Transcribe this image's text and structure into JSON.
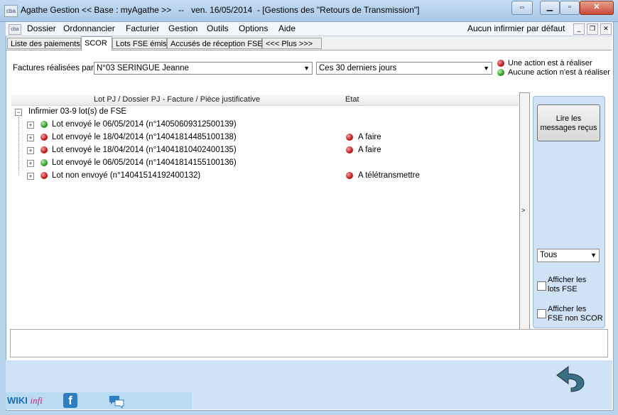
{
  "window": {
    "title": "Agathe Gestion << Base : myAgathe >>   --   ven. 16/05/2014  - [Gestions des \"Retours de Transmission\"]",
    "app_icon_text": "cba"
  },
  "menu": {
    "items": [
      "Dossier",
      "Ordonnancier",
      "Facturier",
      "Gestion",
      "Outils",
      "Options",
      "Aide"
    ],
    "right_status": "Aucun infirmier par défaut"
  },
  "tabs": [
    {
      "label": "Liste des paiements",
      "active": false
    },
    {
      "label": "SCOR",
      "active": true
    },
    {
      "label": "Lots FSE émis",
      "active": false
    },
    {
      "label": "Accusés de réception FSE",
      "active": false
    },
    {
      "label": "<<< Plus >>>",
      "active": false
    }
  ],
  "filters": {
    "by_label": "Factures réalisées par:",
    "practitioner_value": "N°03  SERINGUE Jeanne",
    "period_value": "Ces 30 derniers jours"
  },
  "legend": {
    "action_required": "Une action est à réaliser",
    "no_action": "Aucune action n'est à réaliser",
    "red_color": "#c01818",
    "green_color": "#2e9a2a"
  },
  "tree": {
    "columns": [
      "Lot PJ / Dossier PJ - Facture / Pièce justificative",
      "Etat"
    ],
    "root": "Infirmier 03-9 lot(s) de FSE",
    "rows": [
      {
        "status": "green",
        "label": "Lot envoyé le 06/05/2014 (n°14050609312500139)",
        "state": ""
      },
      {
        "status": "red",
        "label": "Lot envoyé le 18/04/2014 (n°14041814485100138)",
        "state": "A faire"
      },
      {
        "status": "red",
        "label": "Lot envoyé le 18/04/2014 (n°14041810402400135)",
        "state": "A faire"
      },
      {
        "status": "green",
        "label": "Lot envoyé le 06/05/2014 (n°14041814155100136)",
        "state": ""
      },
      {
        "status": "red",
        "label": "Lot non envoyé  (n°14041514192400132)",
        "state": "A télétransmettre"
      }
    ]
  },
  "side_panel": {
    "read_messages_label": "Lire les messages reçus",
    "filter_value": "Tous",
    "show_fse_lots_label": "Afficher les lots FSE",
    "show_non_scor_label": "Afficher les FSE non SCOR",
    "collapse_glyph": ">"
  },
  "footer": {
    "wiki_label": "WIKI",
    "infi_label": "infi",
    "facebook_letter": "f"
  }
}
